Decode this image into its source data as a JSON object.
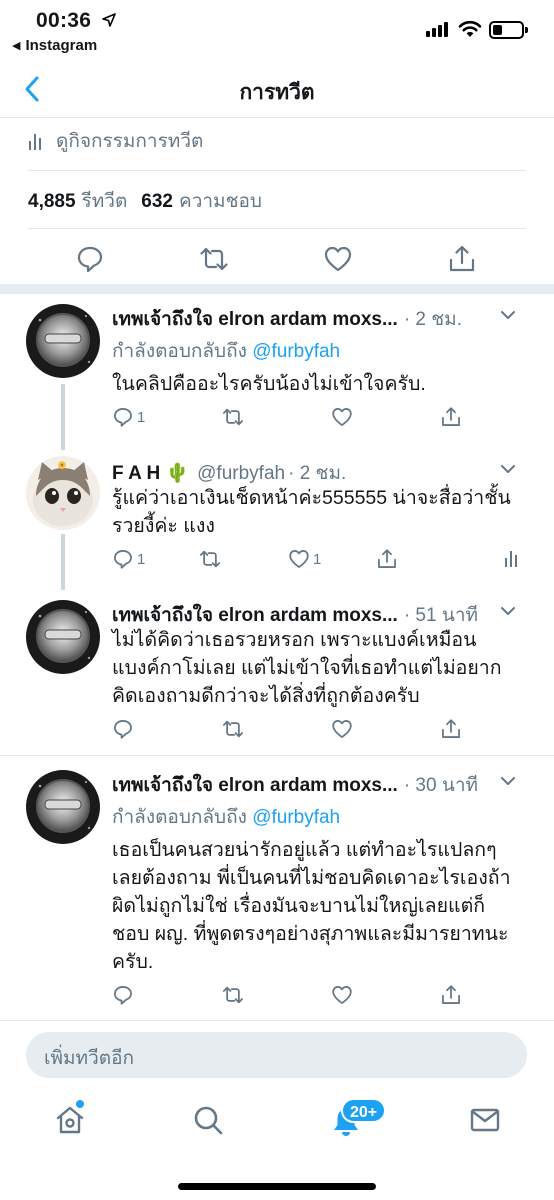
{
  "status_bar": {
    "time": "00:36",
    "back_app": "Instagram"
  },
  "nav": {
    "title": "การทวีต"
  },
  "main_tweet": {
    "activity_label": "ดูกิจกรรมการทวีต",
    "retweets_count": "4,885",
    "retweets_label": "รีทวีต",
    "likes_count": "632",
    "likes_label": "ความชอบ"
  },
  "replies": [
    {
      "name": "เทพเจ้าถึงใจ elron ardam moxs...",
      "handle": "",
      "time": "· 2 ชม.",
      "reply_prefix": "กำลังตอบกลับถึง",
      "reply_to": "@furbyfah",
      "text": "ในคลิปคืออะไรครับน้องไม่เข้าใจครับ.",
      "reply_count": "1",
      "like_count": ""
    },
    {
      "name": "F A H 🌵",
      "handle": "@furbyfah",
      "time": "· 2 ชม.",
      "text": "รู้แค่ว่าเอาเงินเช็ดหน้าค่ะ555555 น่าจะสื่อว่าชั้นรวยงี้ค่ะ แงง",
      "reply_count": "1",
      "like_count": "1"
    },
    {
      "name": "เทพเจ้าถึงใจ elron ardam moxs...",
      "handle": "",
      "time": "· 51 นาที",
      "text": "ไม่ได้คิดว่าเธอรวยหรอก เพราะแบงค์เหมือนแบงค์กาโม่เลย แต่ไม่เข้าใจที่เธอทำแต่ไม่อยากคิดเองถามดีกว่าจะได้สิ่งที่ถูกต้องครับ",
      "reply_count": "",
      "like_count": ""
    },
    {
      "name": "เทพเจ้าถึงใจ elron ardam moxs...",
      "handle": "",
      "time": "· 30 นาที",
      "reply_prefix": "กำลังตอบกลับถึง",
      "reply_to": "@furbyfah",
      "text": "เธอเป็นคนสวยน่ารักอยู่แล้ว แต่ทำอะไรแปลกๆเลยต้องถาม พี่เป็นคนที่ไม่ชอบคิดเดาอะไรเองถ้าผิดไม่ถูกไม่ใช่ เรื่องมันจะบานไม่ใหญ่เลยแต่ก็ชอบ ผญ. ที่พูดตรงๆอย่างสุภาพและมีมารยาทนะครับ.",
      "reply_count": "",
      "like_count": ""
    }
  ],
  "reply_bar": {
    "placeholder": "เพิ่มทวีตอีก"
  },
  "tab_bar": {
    "notifications_badge": "20+"
  },
  "colors": {
    "accent": "#1da1f2",
    "secondary_text": "#657786",
    "separator": "#e6ecf0"
  },
  "icons": [
    "location-arrow-icon",
    "signal-icon",
    "wifi-icon",
    "battery-icon",
    "back-chevron-icon",
    "activity-bars-icon",
    "reply-icon",
    "retweet-icon",
    "like-icon",
    "share-icon",
    "chevron-down-icon",
    "home-icon",
    "search-icon",
    "notifications-icon",
    "messages-icon"
  ]
}
